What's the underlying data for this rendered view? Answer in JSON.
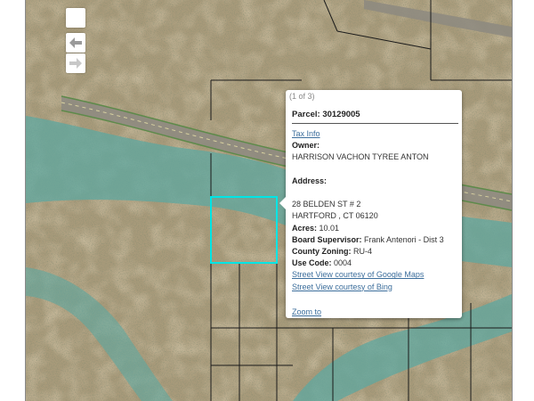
{
  "nav": {
    "home_icon": "blank-square-icon",
    "back_icon": "arrow-left-icon",
    "forward_icon": "arrow-right-icon"
  },
  "popup": {
    "count": "(1 of 3)",
    "title": "Parcel: 30129005",
    "tax_info": "Tax Info",
    "owner_label": "Owner:",
    "owner_name": "HARRISON VACHON TYREE ANTON",
    "address_label": "Address:",
    "address_line1": "28 BELDEN ST # 2",
    "address_line2": "HARTFORD , CT  06120",
    "acres_label": "Acres:",
    "acres_value": "10.01",
    "supervisor_label": "Board Supervisor:",
    "supervisor_value": "Frank Antenori - Dist 3",
    "zoning_label": "County Zoning:",
    "zoning_value": "RU-4",
    "use_code_label": "Use Code:",
    "use_code_value": "0004",
    "street_view_google": "Street View courtesy of Google Maps",
    "street_view_bing": "Street View courtesy of Bing",
    "zoom_to": "Zoom to"
  },
  "colors": {
    "terrain": "#a89a7a",
    "wash": "#5fa8a0",
    "parcel_highlight": "#00e5e5",
    "parcel_lines": "#1a1a1a",
    "link": "#3c6e9c"
  }
}
